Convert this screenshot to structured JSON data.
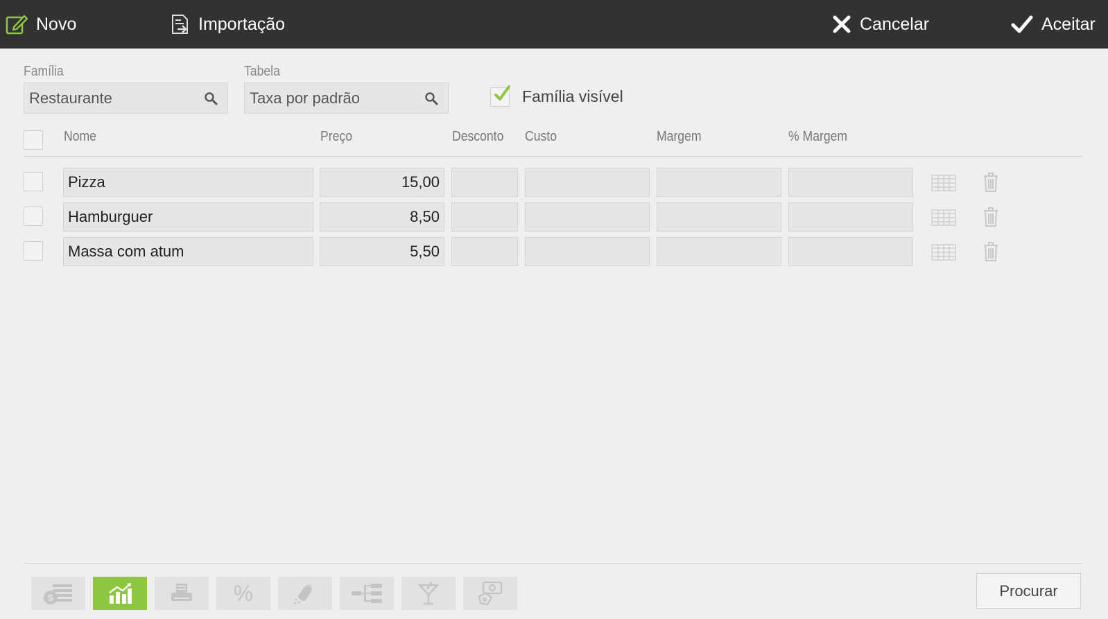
{
  "toolbar": {
    "new_label": "Novo",
    "import_label": "Importação",
    "cancel_label": "Cancelar",
    "accept_label": "Aceitar"
  },
  "filters": {
    "family_label": "Família",
    "family_value": "Restaurante",
    "table_label": "Tabela",
    "table_value": "Taxa por padrão",
    "visible_label": "Família visível",
    "visible_checked": true
  },
  "table": {
    "columns": [
      "Nome",
      "Preço",
      "Desconto",
      "Custo",
      "Margem",
      "% Margem"
    ],
    "rows": [
      {
        "name": "Pizza",
        "price": "15,00",
        "discount": "",
        "cost": "",
        "margin": "",
        "margin_pct": ""
      },
      {
        "name": "Hamburguer",
        "price": "8,50",
        "discount": "",
        "cost": "",
        "margin": "",
        "margin_pct": ""
      },
      {
        "name": "Massa com atum",
        "price": "5,50",
        "discount": "",
        "cost": "",
        "margin": "",
        "margin_pct": ""
      }
    ]
  },
  "bottom": {
    "tabs": [
      {
        "icon": "money-list-icon",
        "active": false
      },
      {
        "icon": "chart-growth-icon",
        "active": true
      },
      {
        "icon": "printer-icon",
        "active": false
      },
      {
        "icon": "percent-icon",
        "active": false
      },
      {
        "icon": "salt-shaker-icon",
        "active": false
      },
      {
        "icon": "hierarchy-icon",
        "active": false
      },
      {
        "icon": "cocktail-icon",
        "active": false
      },
      {
        "icon": "price-tag-icon",
        "active": false
      }
    ],
    "search_label": "Procurar"
  },
  "colors": {
    "accent": "#8dc63f",
    "topbar": "#323232",
    "background": "#efefef"
  }
}
